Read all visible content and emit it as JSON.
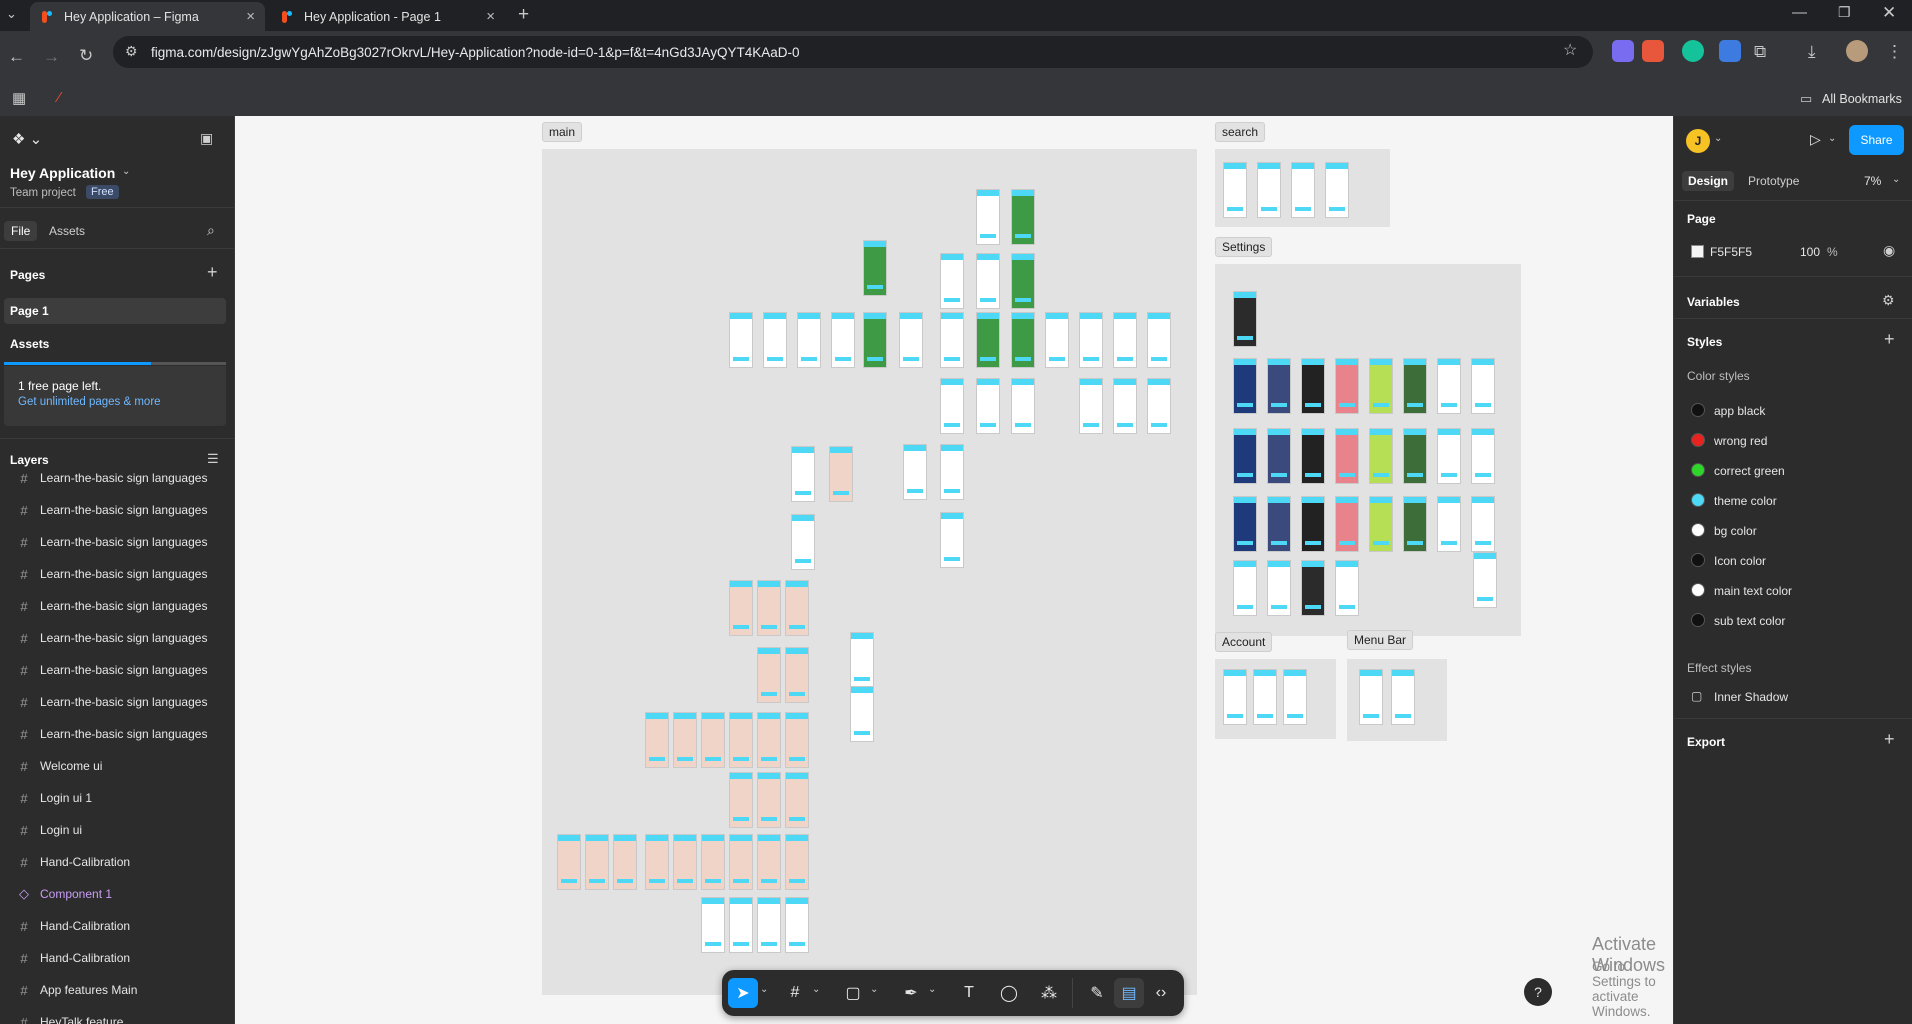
{
  "browser": {
    "tabs": [
      {
        "title": "Hey Application – Figma"
      },
      {
        "title": "Hey Application - Page 1"
      }
    ],
    "url": "figma.com/design/zJgwYgAhZoBg3027rOkrvL/Hey-Application?node-id=0-1&p=f&t=4nGd3JAyQYT4KAaD-0",
    "bookmarks_label": "All Bookmarks"
  },
  "left_panel": {
    "file_name": "Hey Application",
    "team": "Team project",
    "plan_badge": "Free",
    "tabs": [
      "File",
      "Assets"
    ],
    "pages_heading": "Pages",
    "pages": [
      "Page 1",
      "Assets"
    ],
    "notice": "1 free page left.",
    "notice_link": "Get unlimited pages & more",
    "layers_heading": "Layers",
    "layers": [
      {
        "name": "Learn-the-basic sign languages",
        "type": "frame"
      },
      {
        "name": "Learn-the-basic sign languages",
        "type": "frame"
      },
      {
        "name": "Learn-the-basic sign languages",
        "type": "frame"
      },
      {
        "name": "Learn-the-basic sign languages",
        "type": "frame"
      },
      {
        "name": "Learn-the-basic sign languages",
        "type": "frame"
      },
      {
        "name": "Learn-the-basic sign languages",
        "type": "frame"
      },
      {
        "name": "Learn-the-basic sign languages",
        "type": "frame"
      },
      {
        "name": "Learn-the-basic sign languages",
        "type": "frame"
      },
      {
        "name": "Learn-the-basic sign languages",
        "type": "frame"
      },
      {
        "name": "Welcome ui",
        "type": "frame"
      },
      {
        "name": "Login ui 1",
        "type": "frame"
      },
      {
        "name": "Login ui",
        "type": "frame"
      },
      {
        "name": "Hand-Calibration",
        "type": "frame"
      },
      {
        "name": "Component 1",
        "type": "component"
      },
      {
        "name": "Hand-Calibration",
        "type": "frame"
      },
      {
        "name": "Hand-Calibration",
        "type": "frame"
      },
      {
        "name": "App features Main",
        "type": "frame"
      },
      {
        "name": "HeyTalk feature",
        "type": "frame"
      }
    ]
  },
  "canvas": {
    "sections": [
      "main",
      "search",
      "Settings",
      "Account",
      "Menu Bar"
    ],
    "watermark_title": "Activate Windows",
    "watermark_sub": "Go to Settings to activate Windows."
  },
  "right_panel": {
    "avatar_letter": "J",
    "share_label": "Share",
    "tabs": [
      "Design",
      "Prototype"
    ],
    "zoom": "7%",
    "page_heading": "Page",
    "page_color": "F5F5F5",
    "page_opacity": "100",
    "percent": "%",
    "variables_heading": "Variables",
    "styles_heading": "Styles",
    "color_styles_heading": "Color styles",
    "color_styles": [
      {
        "name": "app black",
        "color": "#111111"
      },
      {
        "name": "wrong red",
        "color": "#e8231f"
      },
      {
        "name": "correct green",
        "color": "#2ed62a"
      },
      {
        "name": "theme color",
        "color": "#4dd9f5"
      },
      {
        "name": "bg color",
        "color": "#ffffff"
      },
      {
        "name": "Icon color",
        "color": "#111111"
      },
      {
        "name": "main text color",
        "color": "#ffffff"
      },
      {
        "name": "sub text color",
        "color": "#111111"
      }
    ],
    "effect_styles_heading": "Effect styles",
    "effect_styles": [
      "Inner Shadow"
    ],
    "export_heading": "Export"
  }
}
